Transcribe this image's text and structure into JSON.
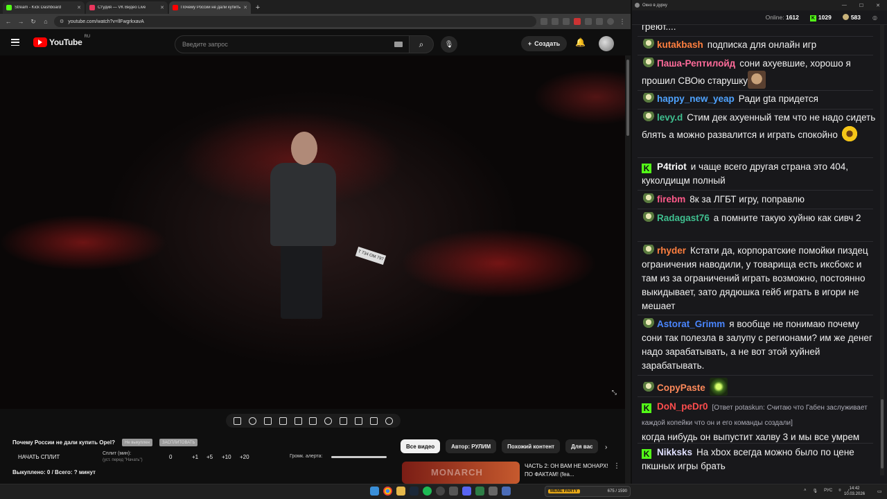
{
  "browser": {
    "tabs": [
      {
        "title": "Stream - Kick Dashboard",
        "color": "#53fc18"
      },
      {
        "title": "Студия — VK Видео Live",
        "color": "#e8365d"
      },
      {
        "title": "Почему России не дали купить",
        "color": "#ff0000"
      }
    ],
    "url": "youtube.com/watch?v=llFwgrkxavA"
  },
  "youtube": {
    "logo_text": "YouTube",
    "region": "RU",
    "search_placeholder": "Введите запрос",
    "create_label": "Создать"
  },
  "video": {
    "plate_text": "Т 734 ОМ 797"
  },
  "panel": {
    "title": "Почему России не дали купить Opel?",
    "tag1": "Не выкуплен",
    "tag2": "ЗАСПЛИТОВАТЬ",
    "split_button": "НАЧАТЬ СПЛИТ",
    "split_label": "Сплит (мин):",
    "split_hint": "(уст. перед \"Начать\")",
    "split_values": [
      "0",
      "+1",
      "+5",
      "+10",
      "+20"
    ],
    "volume_label": "Громк. алерта:",
    "bought": "Выкуплено: 0 / Всего: ? минут"
  },
  "chips": [
    "Все видео",
    "Автор: РУЛИМ",
    "Похожий контент",
    "Для вас"
  ],
  "recommendation": {
    "thumb_text": "MONARCH",
    "title": "ЧАСТЬ 2: ОН ВАМ НЕ МОНАРХ! ПО ФАКТАМ! (fea..."
  },
  "chat": {
    "window_title": "Окно в дурку",
    "online_label": "Online:",
    "online_value": "1612",
    "kick_count": "1029",
    "viewers_count": "583",
    "messages": [
      {
        "user": "",
        "color": "#f0f0f0",
        "text": "греют....",
        "badge": "none"
      },
      {
        "user": "kutakbash",
        "color": "#ff7f3f",
        "text": "подписка для онлайн игр",
        "badge": "sub"
      },
      {
        "user": "Паша-Рептилойд",
        "color": "#ff6b9a",
        "text": "сони ахуевшие, хорошо я прошил СВОю старушку",
        "badge": "sub"
      },
      {
        "user": "happy_new_yeap",
        "color": "#4fa3ff",
        "text": "Ради gta придется",
        "badge": "sub"
      },
      {
        "user": "levy.d",
        "color": "#3fbf8f",
        "text": "Стим дек ахуенный тем что не надо сидеть блять а можно развалится и играть спокойно",
        "badge": "sub"
      },
      {
        "user": "P4triot",
        "color": "#ffffff",
        "text": "и чаще всего другая страна это 404, куколдищм полный",
        "badge": "kick"
      },
      {
        "user": "firebm",
        "color": "#ff5a8a",
        "text": "8к за ЛГБТ игру, поправлю",
        "badge": "sub"
      },
      {
        "user": "Radagast76",
        "color": "#3fbf8f",
        "text": "а помните такую хуйню как сивч 2",
        "badge": "sub"
      },
      {
        "user": "rhyder",
        "color": "#ff7f3f",
        "text": "Кстати да, корпоратские помойки пиздец ограничения наводили, у товарища есть иксбокс и там из за ограничений играть возможно, постоянно выкидывает, зато дядюшка гейб играть в игори не мешает",
        "badge": "sub"
      },
      {
        "user": "Astorat_Grimm",
        "color": "#4a86ff",
        "text": "я вообще не понимаю почему сони так полезла в залупу с регионами? им же денег надо зарабатывать, а не вот этой хуйней зарабатывать.",
        "badge": "sub"
      },
      {
        "user": "CopyPaste",
        "color": "#ff8a5a",
        "text": "",
        "badge": "sub"
      },
      {
        "user": "DoN_peDr0",
        "color": "#ff4d4d",
        "reply": "[Ответ potaskun: Считаю что Габен заслуживает каждой копейки что он и его команды создали]",
        "text": "когда нибудь он выпустит халву 3 и мы все умрем",
        "badge": "kick"
      },
      {
        "user": "Nikksks",
        "color": "#e0e0ff",
        "text": "На xbox всегда можно было по цене пкшных игры брать",
        "badge": "kick"
      }
    ]
  },
  "taskbar": {
    "meme_tag": "MEME PARTY",
    "meme_count": "675 / 1590",
    "lang": "РУС",
    "time": "14:42",
    "date": "10.03.2026"
  }
}
